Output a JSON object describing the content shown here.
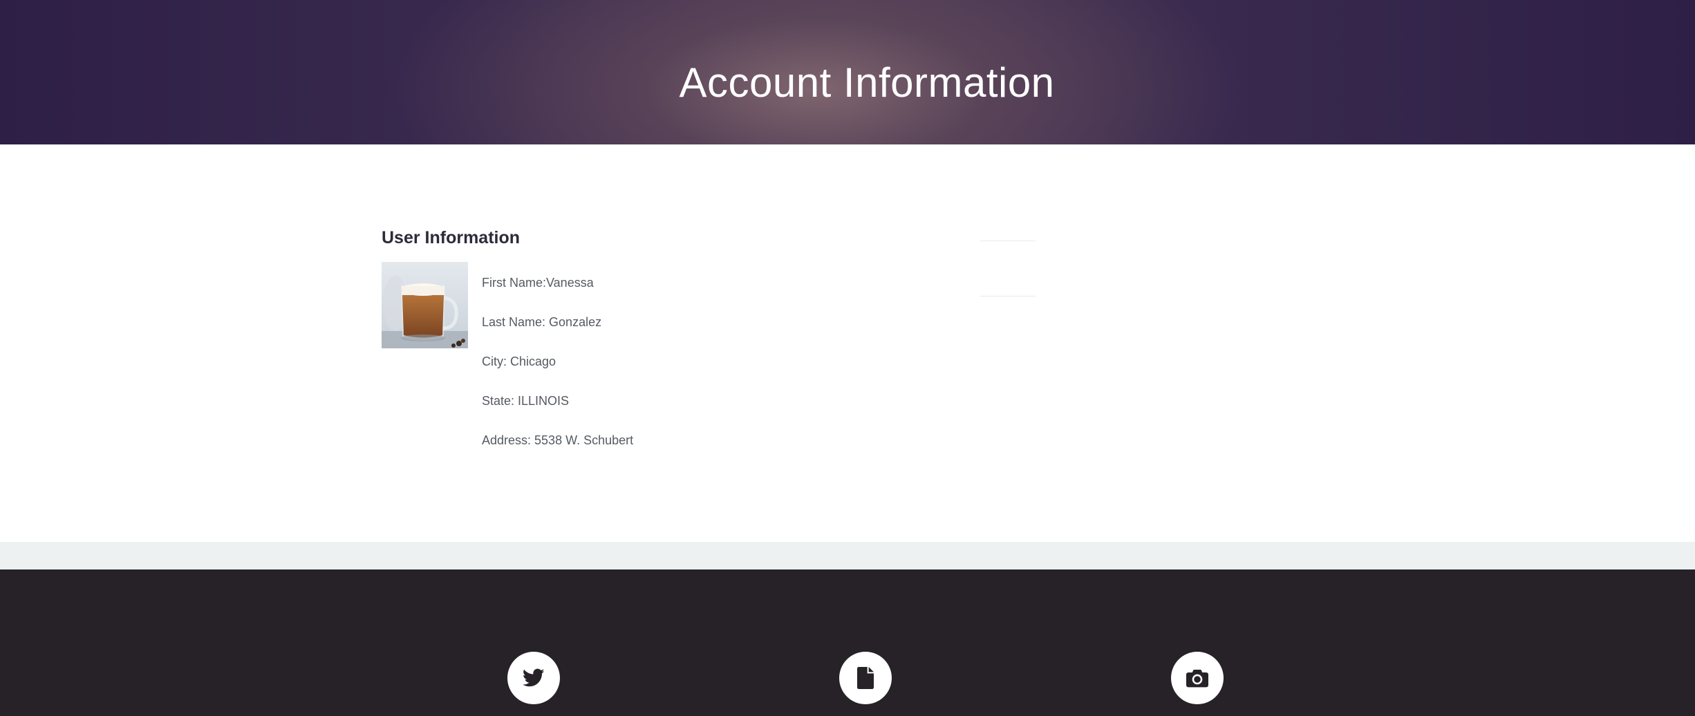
{
  "header": {
    "title": "Account Information"
  },
  "user_info": {
    "section_title": "User Information",
    "photo_alt": "coffee mug",
    "fields": [
      {
        "label": "First Name:Vanessa"
      },
      {
        "label": "Last Name: Gonzalez"
      },
      {
        "label": "City: Chicago"
      },
      {
        "label": "State: ILLINOIS"
      },
      {
        "label": "Address: 5538 W. Schubert"
      }
    ]
  },
  "footer": {
    "social_links": [
      {
        "icon": "twitter-icon"
      },
      {
        "icon": "document-icon"
      },
      {
        "icon": "camera-icon"
      }
    ]
  },
  "colors": {
    "hero_dark": "#2e1f47",
    "footer_bg": "#262228",
    "band_bg": "#edf1f2",
    "text_primary": "#2b2b3a",
    "text_secondary": "#555a62"
  }
}
